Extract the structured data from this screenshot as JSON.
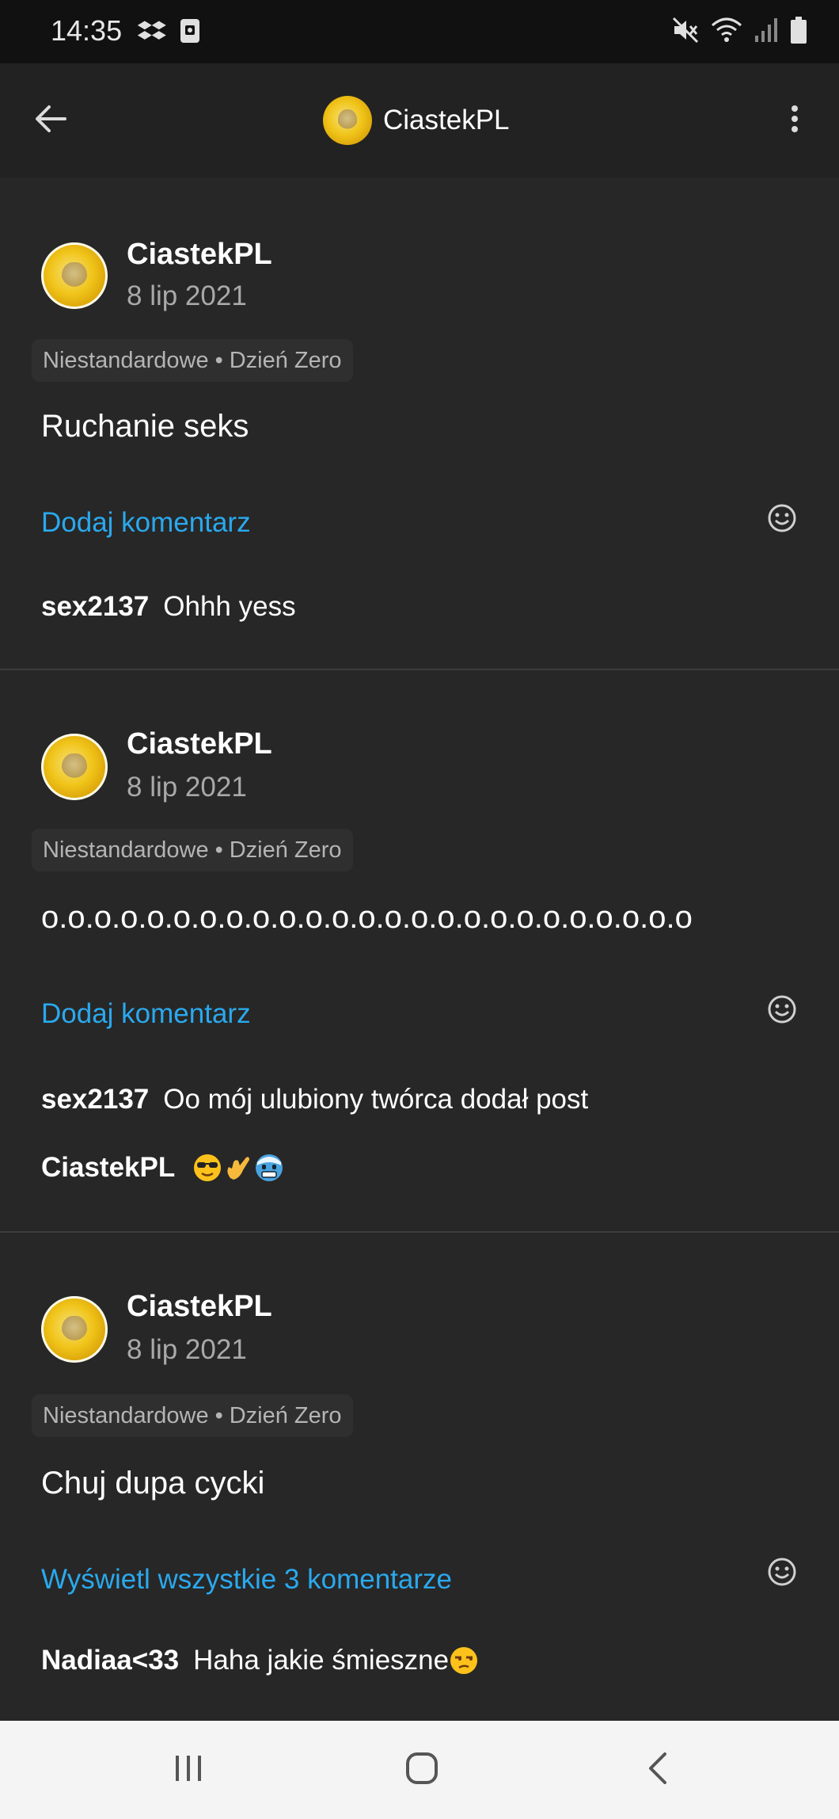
{
  "status_bar": {
    "time": "14:35",
    "left_icons": [
      "dropbox-icon",
      "screenshot-icon"
    ],
    "right_icons": [
      "mute-icon",
      "wifi-icon",
      "signal-icon",
      "battery-icon"
    ]
  },
  "header": {
    "title": "CiastekPL",
    "icons": [
      "back-arrow-icon",
      "more-vert-icon"
    ]
  },
  "posts": [
    {
      "author": "CiastekPL",
      "date": "8 lip 2021",
      "category": "Niestandardowe",
      "separator": "•",
      "tag": "Dzień Zero",
      "text": "Ruchanie seks",
      "comment_action": "Dodaj komentarz",
      "comments": [
        {
          "user": "sex2137",
          "text": "Ohhh yess"
        }
      ]
    },
    {
      "author": "CiastekPL",
      "date": "8 lip 2021",
      "category": "Niestandardowe",
      "separator": "•",
      "tag": "Dzień Zero",
      "text": "o.o.o.o.o.o.o.o.o.o.o.o.o.o.o.o.o.o.o.o.o.o.o.o.o",
      "comment_action": "Dodaj komentarz",
      "comments": [
        {
          "user": "sex2137",
          "text": "Oo mój ulubiony twórca dodał post"
        },
        {
          "user": "CiastekPL",
          "text": "",
          "emojis": [
            "sunglasses-emoji",
            "call-me-hand-emoji",
            "cold-face-emoji"
          ]
        }
      ]
    },
    {
      "author": "CiastekPL",
      "date": "8 lip 2021",
      "category": "Niestandardowe",
      "separator": "•",
      "tag": "Dzień Zero",
      "text": "Chuj dupa cycki",
      "comment_action": "Wyświetl wszystkie 3 komentarze",
      "comments": [
        {
          "user": "Nadiaa<33",
          "text": "Haha jakie śmieszne",
          "emojis": [
            "unamused-face-emoji"
          ]
        }
      ]
    }
  ],
  "nav_bar": {
    "icons": [
      "recents-icon",
      "home-icon",
      "back-icon"
    ]
  },
  "colors": {
    "background": "#272727",
    "app_bar": "#222222",
    "status_bar": "#111111",
    "link": "#2aa9ee",
    "secondary_text": "#a9a9a9",
    "nav_bar": "#f4f4f4"
  }
}
